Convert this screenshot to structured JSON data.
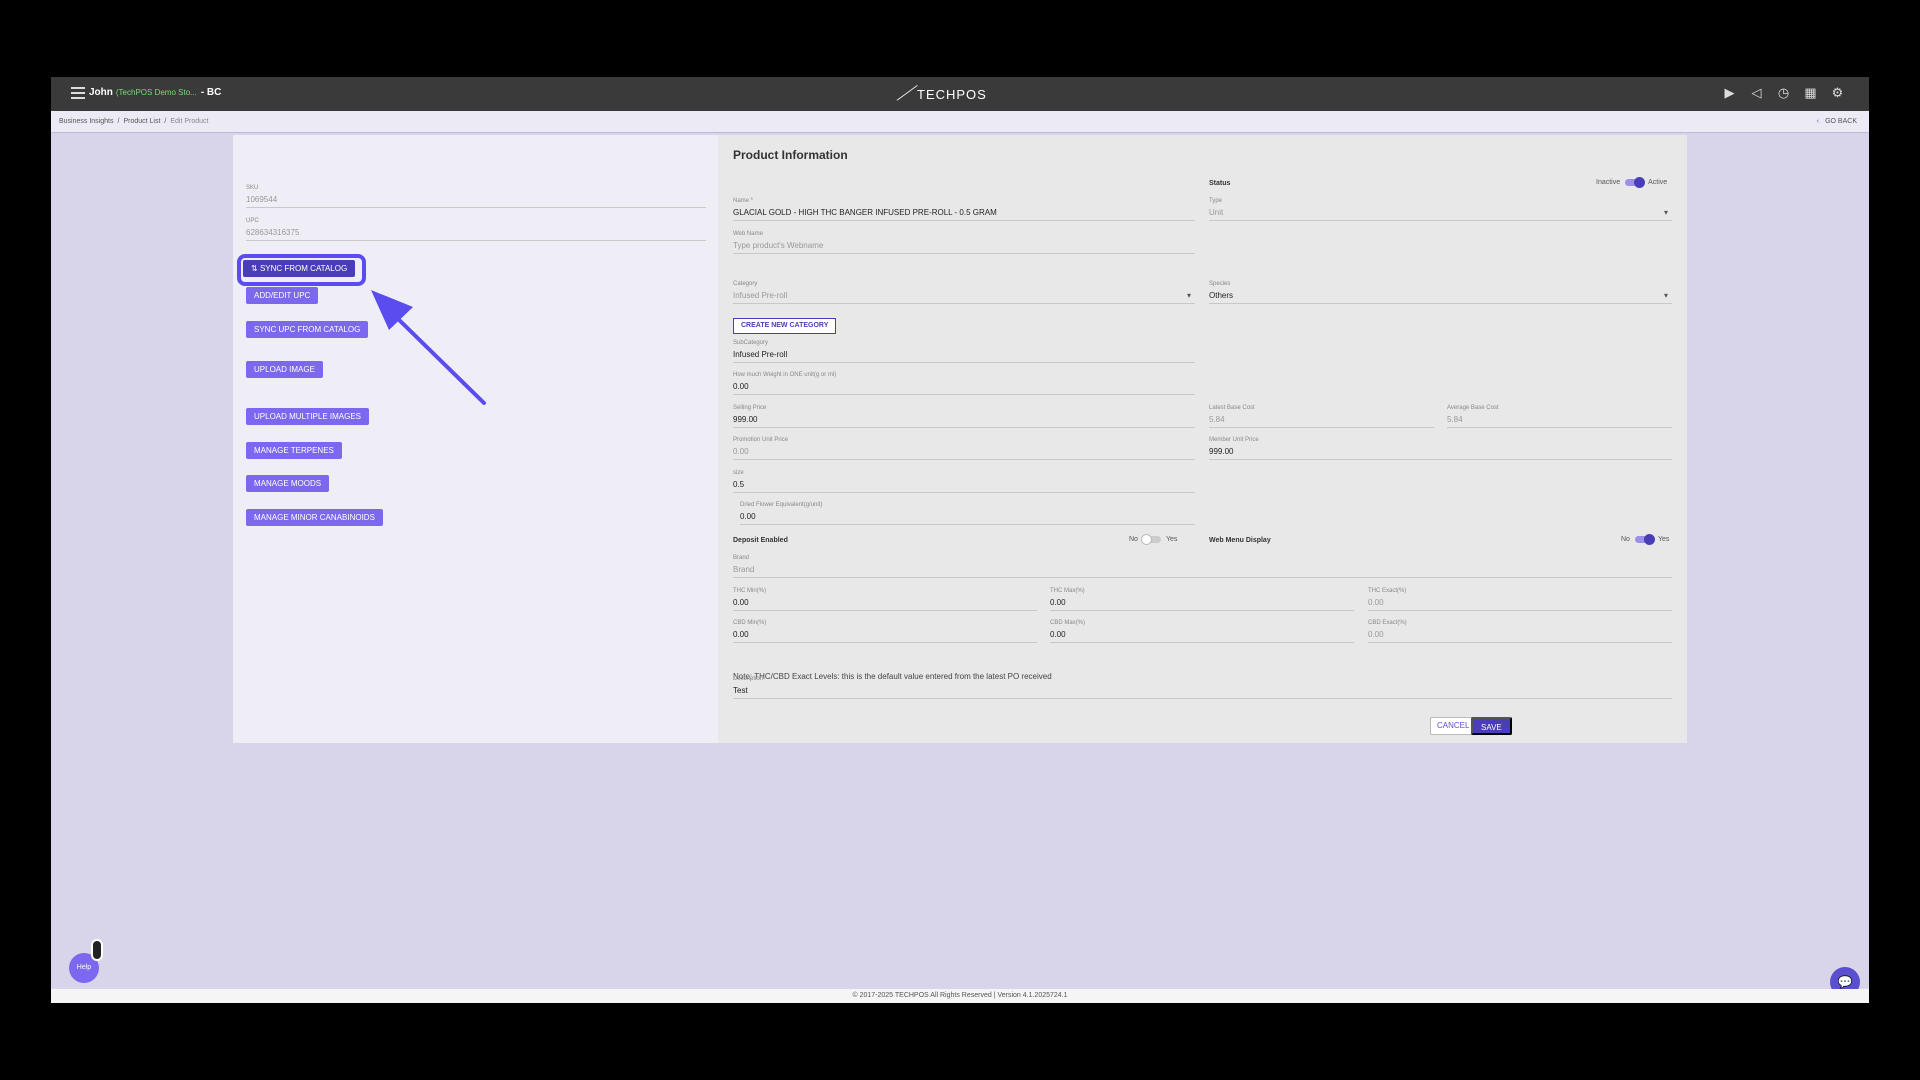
{
  "header": {
    "user_name": "John",
    "store": "(TechPOS Demo Sto...",
    "region": "- BC",
    "logo_text": "TECHPOS",
    "icons": [
      "video-icon",
      "megaphone-icon",
      "clock-icon",
      "calendar-icon",
      "gear-icon"
    ]
  },
  "breadcrumb": {
    "items": [
      "Business Insights",
      "Product List",
      "Edit Product"
    ],
    "separator": "/",
    "go_back": "GO BACK"
  },
  "left": {
    "sku_label": "SKU",
    "sku_value": "1069544",
    "upc_label": "UPC",
    "upc_value": "628634316375",
    "buttons": {
      "sync_catalog": "SYNC FROM CATALOG",
      "add_edit_upc": "ADD/EDIT UPC",
      "sync_upc": "SYNC UPC FROM CATALOG",
      "upload_image": "UPLOAD IMAGE",
      "upload_multiple": "UPLOAD MULTIPLE IMAGES",
      "manage_terpenes": "MANAGE TERPENES",
      "manage_moods": "MANAGE MOODS",
      "manage_minor": "MANAGE MINOR CANABINOIDS"
    }
  },
  "right": {
    "title": "Product Information",
    "status_label": "Status",
    "status_inactive": "Inactive",
    "status_active": "Active",
    "name_label": "Name *",
    "name_value": "GLACIAL GOLD - HIGH THC BANGER INFUSED PRE-ROLL - 0.5 GRAM",
    "type_label": "Type",
    "type_value": "Unit",
    "webname_label": "Web Name",
    "webname_placeholder": "Type product's Webname",
    "category_label": "Category",
    "category_value": "Infused Pre-roll",
    "species_label": "Species",
    "species_value": "Others",
    "create_category": "CREATE NEW CATEGORY",
    "subcategory_label": "SubCategory",
    "subcategory_value": "Infused Pre-roll",
    "weight_label": "How much Weight in ONE unit(g or ml)",
    "weight_value": "0.00",
    "selling_label": "Selling Price",
    "selling_value": "999.00",
    "latest_cost_label": "Latest Base Cost",
    "latest_cost_value": "5.84",
    "avg_cost_label": "Average Base Cost",
    "avg_cost_value": "5.84",
    "promo_label": "Promotion Unit Price",
    "promo_value": "0.00",
    "member_label": "Member Unit Price",
    "member_value": "999.00",
    "size_label": "size",
    "size_value": "0.5",
    "dried_label": "Dried Flower Equivalent(g/unit)",
    "dried_value": "0.00",
    "deposit_label": "Deposit Enabled",
    "deposit_no": "No",
    "deposit_yes": "Yes",
    "webmenu_label": "Web Menu Display",
    "webmenu_no": "No",
    "webmenu_yes": "Yes",
    "brand_label": "Brand",
    "brand_placeholder": "Brand",
    "thc_min_label": "THC Min(%)",
    "thc_min_value": "0.00",
    "thc_max_label": "THC Max(%)",
    "thc_max_value": "0.00",
    "thc_exact_label": "THC Exact(%)",
    "thc_exact_value": "0.00",
    "cbd_min_label": "CBD Min(%)",
    "cbd_min_value": "0.00",
    "cbd_max_label": "CBD Max(%)",
    "cbd_max_value": "0.00",
    "cbd_exact_label": "CBD Exact(%)",
    "cbd_exact_value": "0.00",
    "note": "Note: THC/CBD Exact Levels: this is the default value entered from the latest PO received",
    "description_label": "Description",
    "description_value": "Test",
    "cancel": "CANCEL",
    "save": "SAVE"
  },
  "help_label": "Help",
  "footer": "© 2017-2025 TECHPOS All Rights Reserved | Version 4.1.2025724.1",
  "colors": {
    "accent": "#7b68ee",
    "accent_dark": "#4a3db8",
    "background": "#d8d5ea",
    "topbar": "#3a3a3a"
  }
}
